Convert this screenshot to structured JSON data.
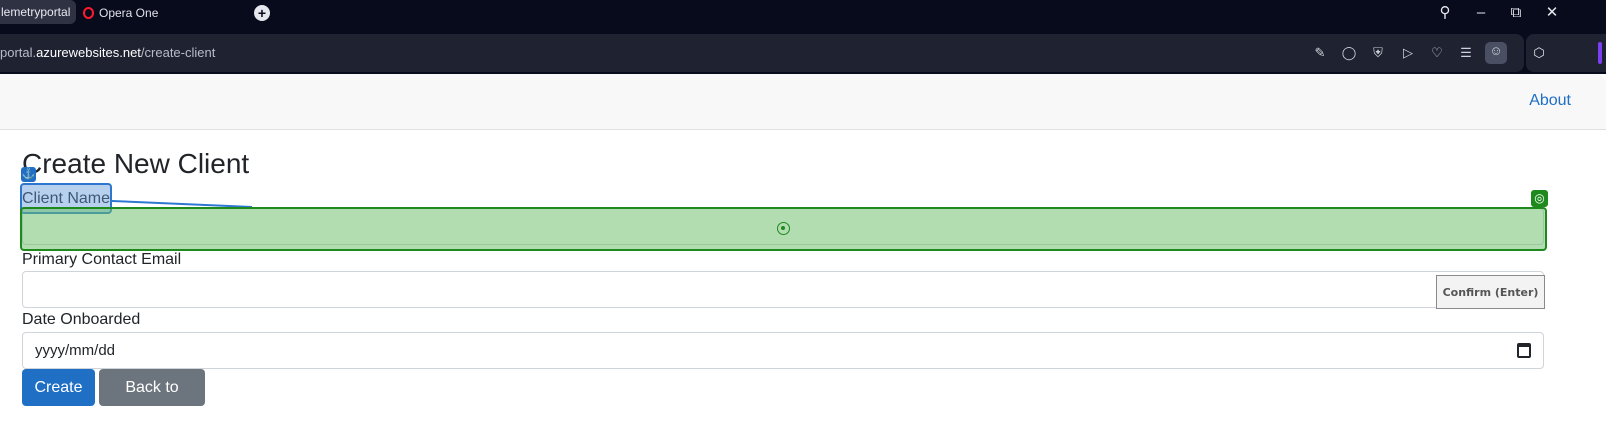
{
  "browser": {
    "tabs": [
      {
        "label": "lemetryportal",
        "active": true
      },
      {
        "label": "Opera One",
        "active": false
      }
    ],
    "url": {
      "prefix": "portal.",
      "domain": "azurewebsites.net",
      "path": "/create-client"
    },
    "icons": [
      "new-tab-icon",
      "search-icon",
      "minimize-icon",
      "restore-icon",
      "close-icon",
      "edit-icon",
      "camera-icon",
      "shield-icon",
      "send-icon",
      "heart-icon",
      "menu-icon",
      "profile-icon",
      "cube-icon"
    ]
  },
  "navbar": {
    "about_label": "About"
  },
  "page": {
    "title": "Create New Client",
    "fields": {
      "client_name_label": "Client Name",
      "email_label": "Primary Contact Email",
      "date_label": "Date Onboarded",
      "date_placeholder": "yyyy/mm/dd"
    },
    "buttons": {
      "create": "Create",
      "back": "Back to List"
    }
  },
  "overlay": {
    "confirm_label": "Confirm (Enter)"
  },
  "colors": {
    "primary": "#1f6fc5",
    "secondary": "#6c757d",
    "highlight_green": "#1e8a1e",
    "highlight_blue": "#2d77d0"
  }
}
